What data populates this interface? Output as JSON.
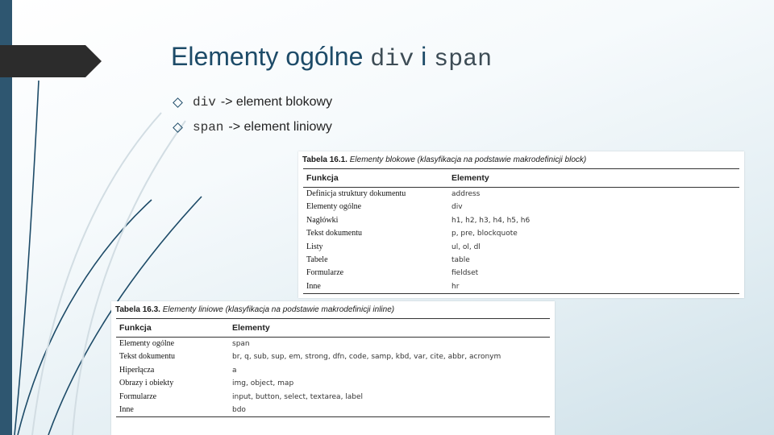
{
  "title": {
    "prefix": "Elementy ogólne",
    "code1": "div",
    "connector": "i",
    "code2": "span"
  },
  "bullets": [
    {
      "code": "div",
      "text": "-> element blokowy"
    },
    {
      "code": "span",
      "text": "-> element liniowy"
    }
  ],
  "table1": {
    "caption_number": "Tabela 16.1.",
    "caption_text": "Elementy blokowe (klasyfikacja na podstawie makrodefinicji block)",
    "headers": [
      "Funkcja",
      "Elementy"
    ],
    "rows": [
      [
        "Definicja struktury dokumentu",
        "address"
      ],
      [
        "Elementy ogólne",
        "div"
      ],
      [
        "Nagłówki",
        "h1, h2, h3, h4, h5, h6"
      ],
      [
        "Tekst dokumentu",
        "p, pre, blockquote"
      ],
      [
        "Listy",
        "ul, ol, dl"
      ],
      [
        "Tabele",
        "table"
      ],
      [
        "Formularze",
        "fieldset"
      ],
      [
        "Inne",
        "hr"
      ]
    ]
  },
  "table2": {
    "caption_number": "Tabela 16.3.",
    "caption_text": "Elementy liniowe (klasyfikacja na podstawie makrodefinicji inline)",
    "headers": [
      "Funkcja",
      "Elementy"
    ],
    "rows": [
      [
        "Elementy ogólne",
        "span"
      ],
      [
        "Tekst dokumentu",
        "br, q, sub, sup, em, strong, dfn, code, samp, kbd, var, cite, abbr, acronym"
      ],
      [
        "Hiperłącza",
        "a"
      ],
      [
        "Obrazy i obiekty",
        "img, object, map"
      ],
      [
        "Formularze",
        "input, button, select, textarea, label"
      ],
      [
        "Inne",
        "bdo"
      ]
    ]
  },
  "colors": {
    "sidebar": "#2e5670",
    "title_tab": "#2c2c2c",
    "title_text": "#1d4b68"
  }
}
